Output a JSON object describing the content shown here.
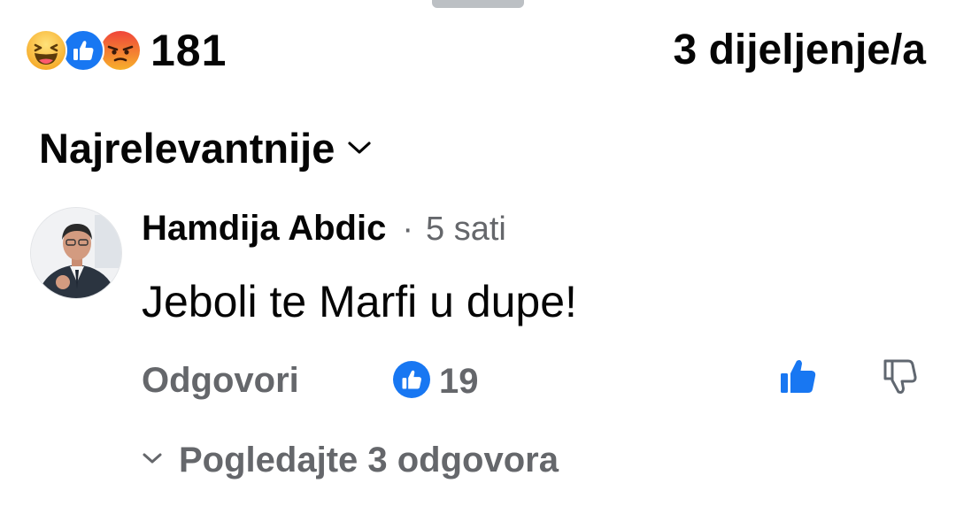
{
  "reactions": {
    "icons": [
      "haha-icon",
      "like-icon",
      "angry-icon"
    ],
    "count": "181"
  },
  "shares": {
    "label": "3 dijeljenje/a"
  },
  "sort": {
    "label": "Najrelevantnije",
    "icon": "chevron-down-icon"
  },
  "comment": {
    "author": "Hamdija Abdic",
    "separator": "·",
    "time": "5 sati",
    "text": "Jeboli te Marfi u dupe!",
    "reply_label": "Odgovori",
    "like_count": "19",
    "view_replies_label": "Pogledajte 3 odgovora"
  },
  "colors": {
    "like_blue": "#1877f2",
    "secondary_text": "#65676b",
    "primary_text": "#050505",
    "haha_yellow": "#f7b928",
    "angry_orange": "#e9710f"
  }
}
